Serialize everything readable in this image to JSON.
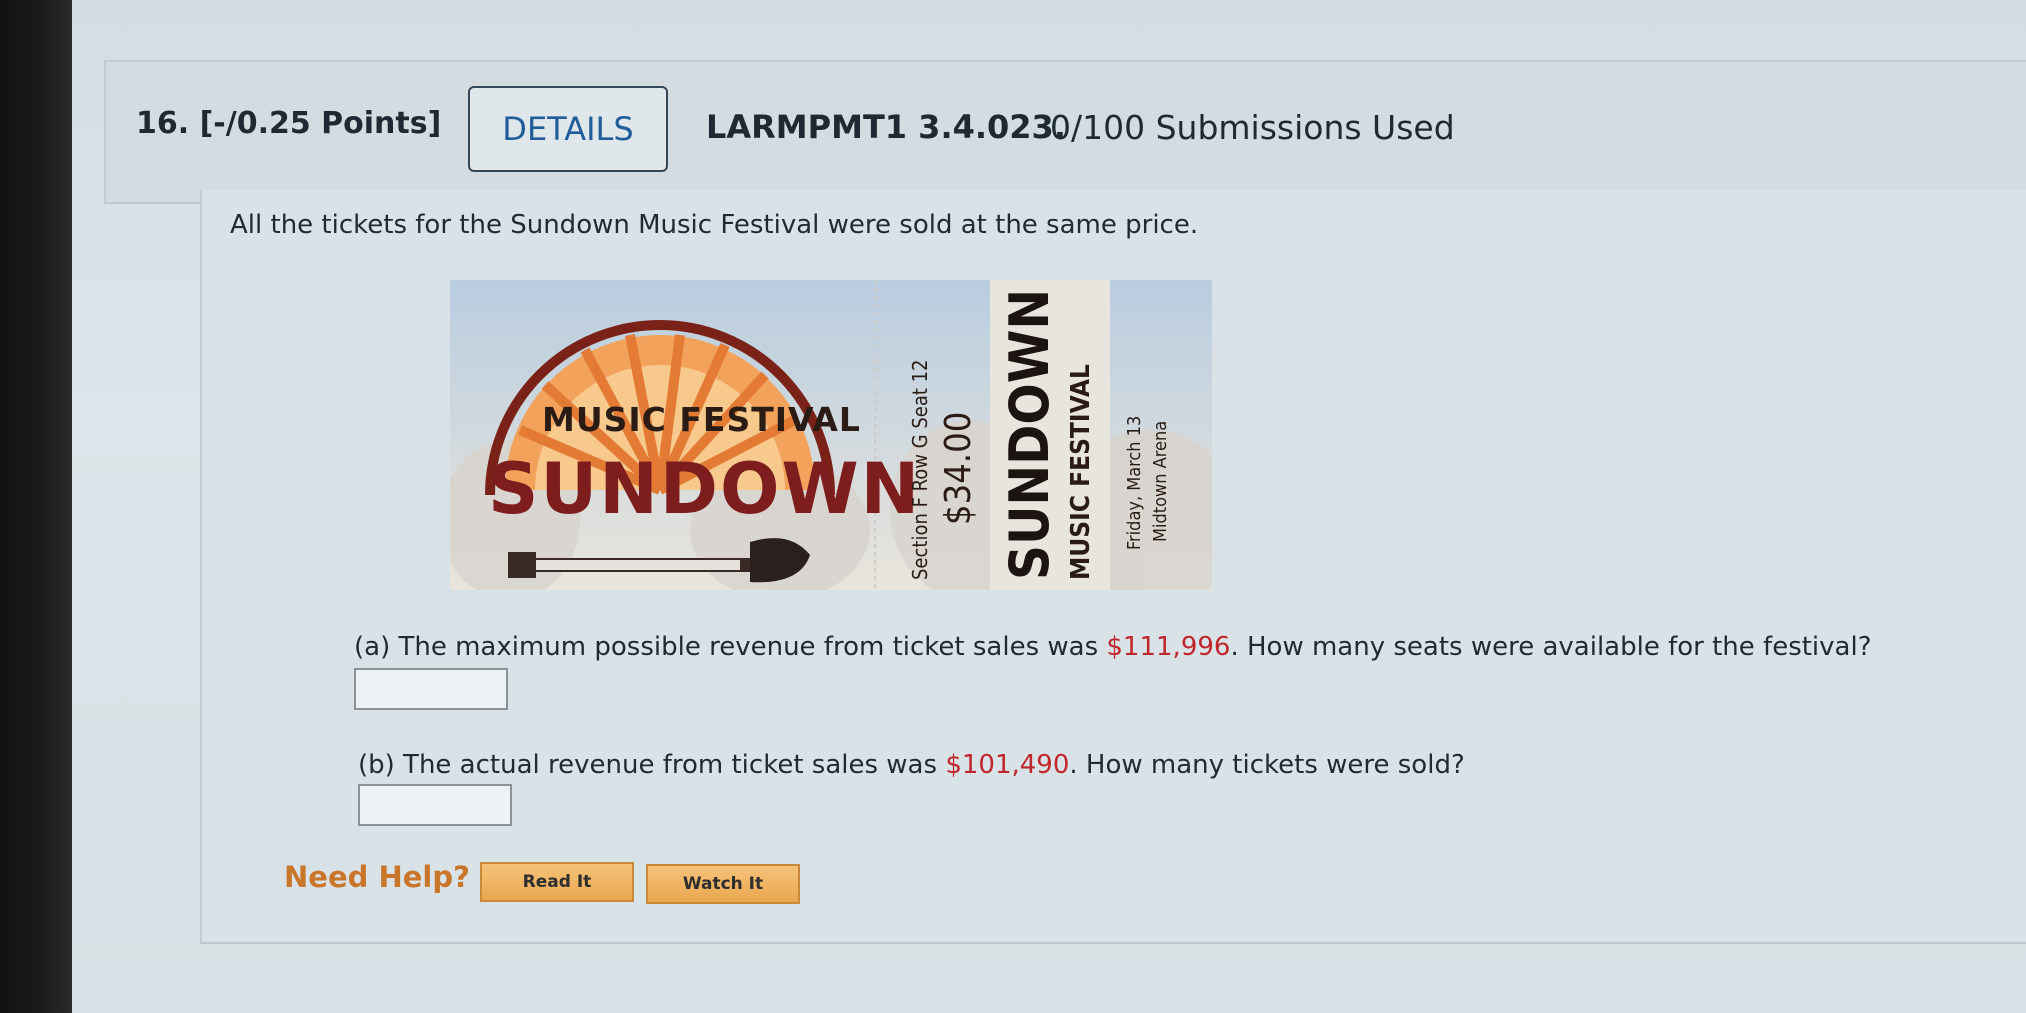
{
  "question": {
    "number_points": "16. [-/0.25 Points]",
    "details_label": "DETAILS",
    "code": "LARMPMT1 3.4.023.",
    "submissions": "0/100 Submissions Used"
  },
  "intro": "All the tickets for the Sundown Music Festival were sold at the same price.",
  "ticket": {
    "main_top": "MUSIC FESTIVAL",
    "main_big": "SUNDOWN",
    "stub_seat": "Section F   Row G   Seat 12",
    "stub_price": "$34.00",
    "stub_name": "SUNDOWN",
    "stub_sub": "MUSIC FESTIVAL",
    "stub_date": "Friday, March 13",
    "stub_venue": "Midtown Arena"
  },
  "part_a": {
    "prefix": "(a) The maximum possible revenue from ticket sales was ",
    "amount": "$111,996",
    "suffix": ". How many seats were available for the festival?",
    "answer_value": ""
  },
  "part_b": {
    "prefix": "(b) The actual revenue from ticket sales was ",
    "amount": "$101,490",
    "suffix": ". How many tickets were sold?",
    "answer_value": ""
  },
  "help": {
    "label": "Need Help?",
    "read_label": "Read It",
    "watch_label": "Watch It"
  },
  "colors": {
    "link_blue": "#1f5c99",
    "money_red": "#c0272d",
    "help_orange": "#c9752a"
  }
}
